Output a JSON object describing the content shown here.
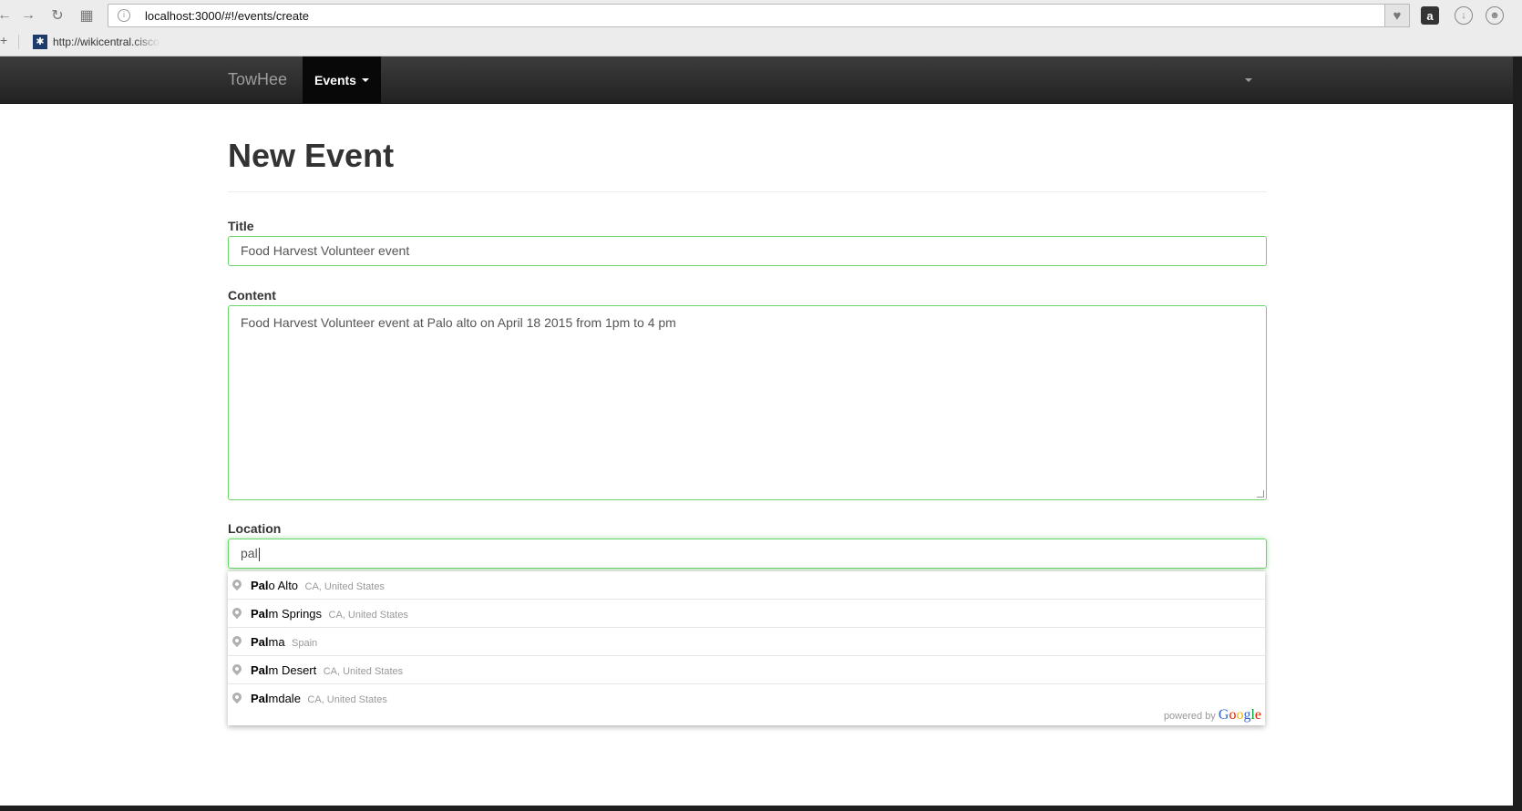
{
  "browser": {
    "url": "localhost:3000/#!/events/create",
    "bookmark_link": "http://wikicentral.cisco.com",
    "amazon_label": "a"
  },
  "navbar": {
    "brand": "TowHee",
    "events_menu": "Events"
  },
  "page": {
    "title": "New Event"
  },
  "form": {
    "title_label": "Title",
    "title_value": "Food Harvest Volunteer event",
    "content_label": "Content",
    "content_value": "Food Harvest Volunteer event  at Palo alto on April 18 2015 from 1pm to 4 pm",
    "location_label": "Location",
    "location_value": "pal"
  },
  "autocomplete": {
    "items": [
      {
        "match": "Pal",
        "rest": "o Alto",
        "secondary": "CA, United States"
      },
      {
        "match": "Pal",
        "rest": "m Springs",
        "secondary": "CA, United States"
      },
      {
        "match": "Pal",
        "rest": "ma",
        "secondary": "Spain"
      },
      {
        "match": "Pal",
        "rest": "m Desert",
        "secondary": "CA, United States"
      },
      {
        "match": "Pal",
        "rest": "mdale",
        "secondary": "CA, United States"
      }
    ],
    "powered_by": "powered by",
    "google": "Google"
  },
  "colors": {
    "field_border": "#6bd46b",
    "navbar_bg": "#222222",
    "google_blue": "#3366cc"
  }
}
